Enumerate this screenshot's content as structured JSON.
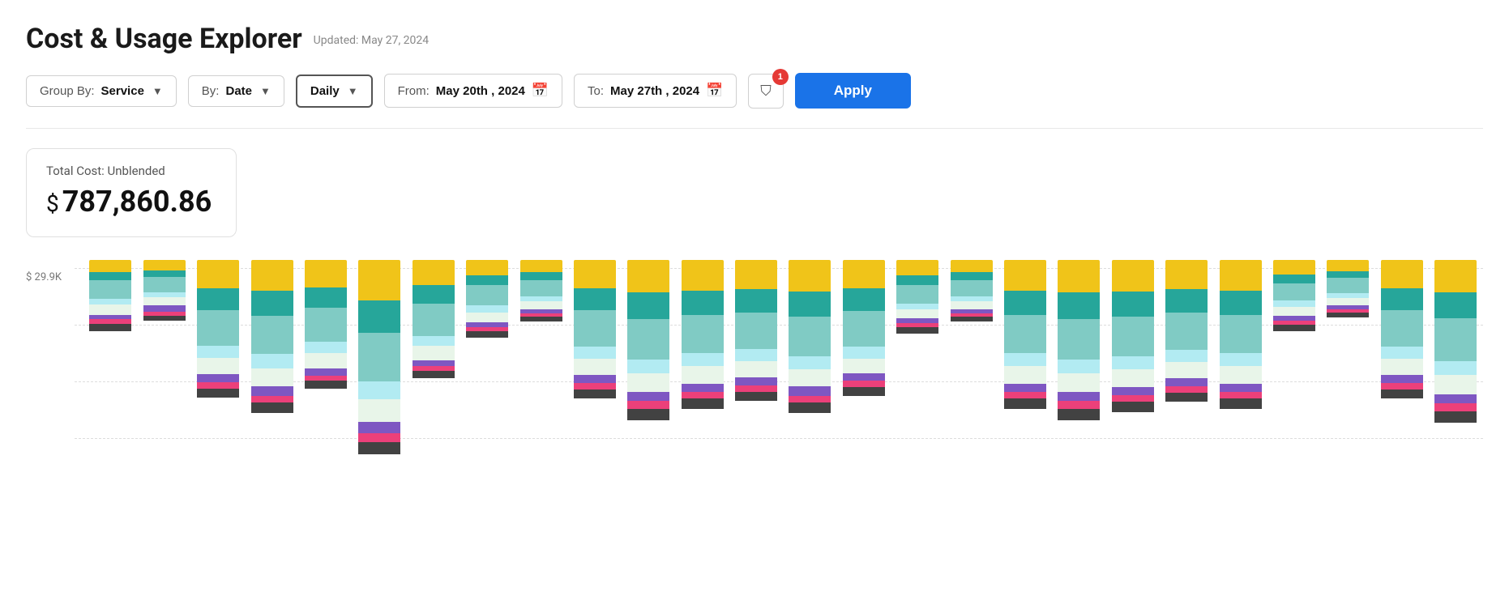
{
  "header": {
    "title": "Cost & Usage Explorer",
    "updated": "Updated: May 27, 2024"
  },
  "toolbar": {
    "group_by_label": "Group By: ",
    "group_by_value": "Service",
    "by_label": "By: ",
    "by_value": "Date",
    "granularity_value": "Daily",
    "from_label": "From: ",
    "from_value": "May 20th , 2024",
    "to_label": "To: ",
    "to_value": "May 27th , 2024",
    "filter_count": "1",
    "apply_label": "Apply"
  },
  "cost_card": {
    "label": "Total Cost: Unblended",
    "currency": "$",
    "value": "787,860.86"
  },
  "chart": {
    "y_label": "$ 29.9K",
    "bars": [
      {
        "segments": [
          12,
          8,
          18,
          6,
          10,
          4,
          5,
          7
        ]
      },
      {
        "segments": [
          10,
          7,
          15,
          5,
          8,
          6,
          4,
          5
        ]
      },
      {
        "segments": [
          28,
          22,
          35,
          12,
          16,
          8,
          6,
          9
        ]
      },
      {
        "segments": [
          30,
          25,
          38,
          14,
          18,
          9,
          7,
          10
        ]
      },
      {
        "segments": [
          27,
          20,
          34,
          11,
          15,
          7,
          5,
          8
        ]
      },
      {
        "segments": [
          40,
          32,
          48,
          18,
          22,
          11,
          9,
          12
        ]
      },
      {
        "segments": [
          25,
          18,
          32,
          10,
          14,
          6,
          5,
          7
        ]
      },
      {
        "segments": [
          15,
          10,
          20,
          7,
          10,
          5,
          4,
          6
        ]
      },
      {
        "segments": [
          12,
          8,
          16,
          5,
          8,
          4,
          3,
          5
        ]
      },
      {
        "segments": [
          28,
          22,
          36,
          12,
          16,
          8,
          6,
          9
        ]
      },
      {
        "segments": [
          32,
          26,
          40,
          14,
          18,
          9,
          8,
          11
        ]
      },
      {
        "segments": [
          30,
          24,
          38,
          13,
          17,
          8,
          7,
          10
        ]
      },
      {
        "segments": [
          29,
          23,
          36,
          12,
          16,
          8,
          6,
          9
        ]
      },
      {
        "segments": [
          31,
          25,
          39,
          13,
          17,
          9,
          7,
          10
        ]
      },
      {
        "segments": [
          28,
          22,
          35,
          12,
          15,
          7,
          6,
          9
        ]
      },
      {
        "segments": [
          15,
          10,
          18,
          6,
          9,
          5,
          4,
          6
        ]
      },
      {
        "segments": [
          12,
          8,
          16,
          5,
          8,
          4,
          3,
          5
        ]
      },
      {
        "segments": [
          30,
          24,
          38,
          13,
          17,
          8,
          7,
          10
        ]
      },
      {
        "segments": [
          32,
          26,
          40,
          14,
          18,
          9,
          8,
          11
        ]
      },
      {
        "segments": [
          31,
          25,
          39,
          13,
          17,
          8,
          7,
          10
        ]
      },
      {
        "segments": [
          29,
          23,
          37,
          12,
          16,
          8,
          6,
          9
        ]
      },
      {
        "segments": [
          30,
          24,
          38,
          13,
          17,
          8,
          7,
          10
        ]
      },
      {
        "segments": [
          14,
          9,
          17,
          6,
          9,
          5,
          4,
          6
        ]
      },
      {
        "segments": [
          11,
          7,
          15,
          5,
          7,
          4,
          3,
          5
        ]
      },
      {
        "segments": [
          28,
          22,
          36,
          12,
          16,
          8,
          6,
          9
        ]
      },
      {
        "segments": [
          32,
          26,
          42,
          14,
          19,
          9,
          8,
          11
        ]
      }
    ],
    "colors": [
      "#f0c419",
      "#26a69a",
      "#80cbc4",
      "#b2ebf2",
      "#e8f5e9",
      "#7e57c2",
      "#ec407a",
      "#424242"
    ]
  }
}
